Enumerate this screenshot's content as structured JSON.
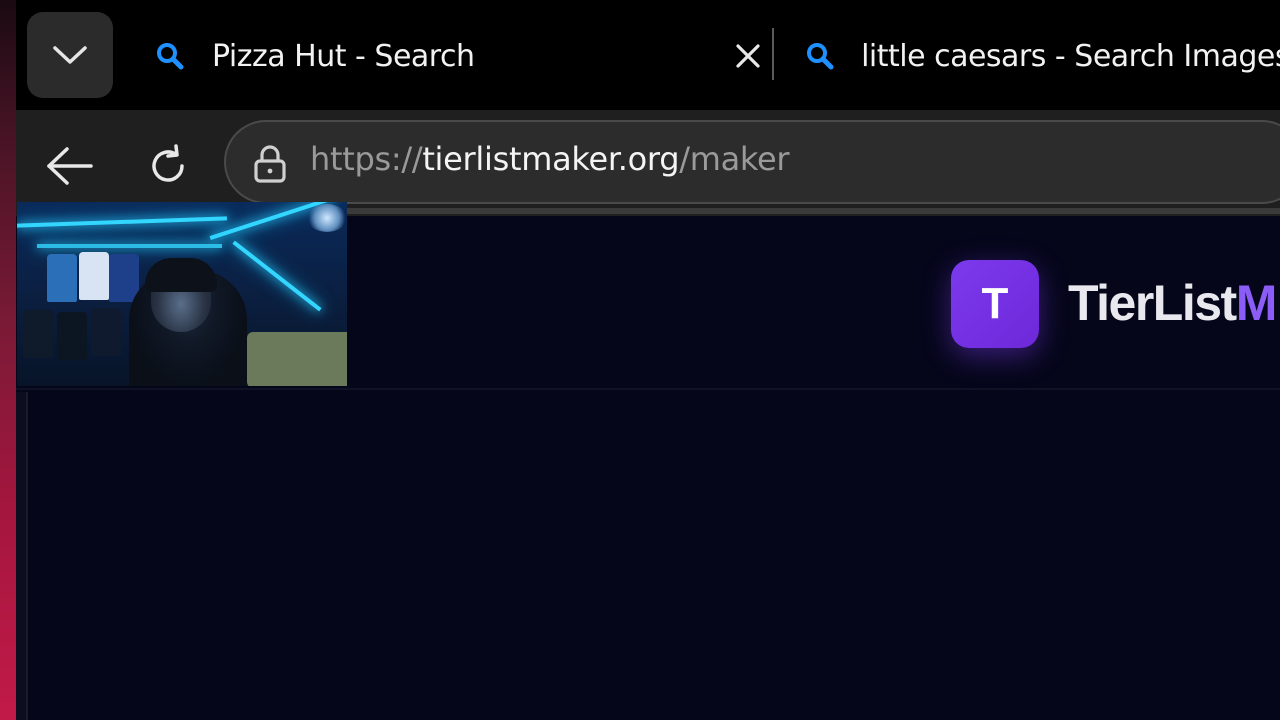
{
  "browser": {
    "tabs": [
      {
        "title": "Pizza Hut - Search",
        "icon": "search-icon",
        "active": true
      },
      {
        "title": "little caesars - Search Images",
        "icon": "search-icon",
        "active": false
      }
    ],
    "address_bar": {
      "scheme": "https://",
      "host": "tierlistmaker.org",
      "path": "/maker"
    }
  },
  "site": {
    "logo_letter": "T",
    "brand_visible_part1": "TierList",
    "brand_visible_part2": "M",
    "accent_color": "#7c3aed"
  },
  "colors": {
    "favicon_blue": "#1e90ff",
    "page_background": "#05061a",
    "toolbar_background": "#1f1f1f"
  }
}
